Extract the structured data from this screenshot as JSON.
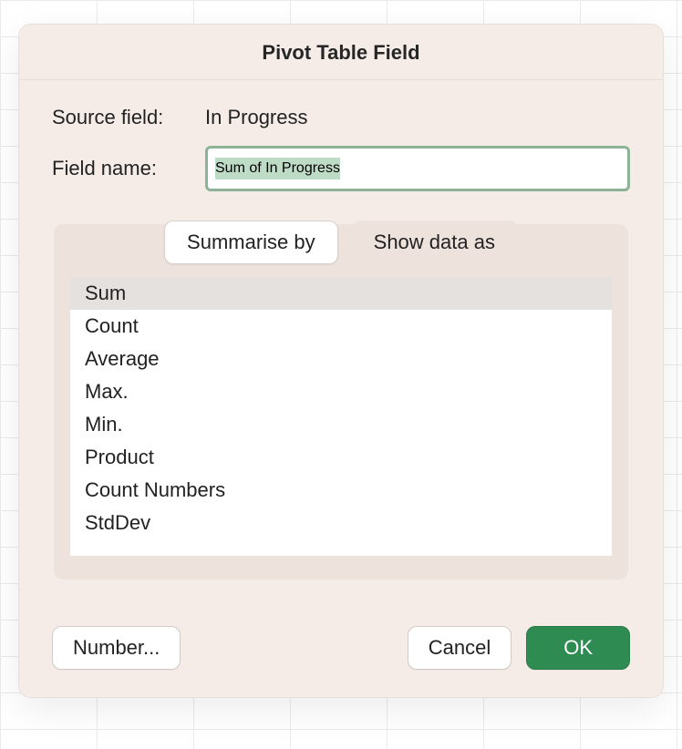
{
  "dialog": {
    "title": "Pivot Table Field",
    "source_field_label": "Source field:",
    "source_field_value": "In Progress",
    "field_name_label": "Field name:",
    "field_name_value": "Sum of In Progress",
    "tabs": [
      {
        "label": "Summarise by",
        "active": true
      },
      {
        "label": "Show data as",
        "active": false
      }
    ],
    "functions": [
      {
        "label": "Sum",
        "selected": true
      },
      {
        "label": "Count"
      },
      {
        "label": "Average"
      },
      {
        "label": "Max."
      },
      {
        "label": "Min."
      },
      {
        "label": "Product"
      },
      {
        "label": "Count Numbers"
      },
      {
        "label": "StdDev"
      }
    ],
    "buttons": {
      "number": "Number...",
      "cancel": "Cancel",
      "ok": "OK"
    }
  }
}
